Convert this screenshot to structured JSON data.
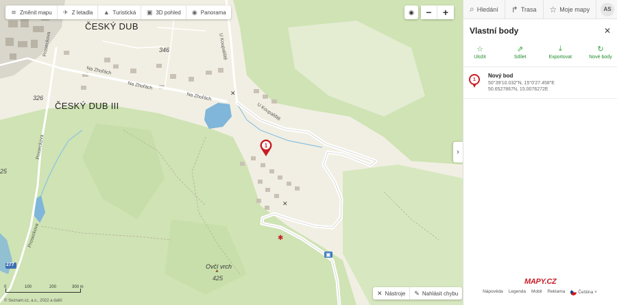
{
  "map": {
    "toolbar": [
      {
        "icon": "layers-icon",
        "label": "Změnit mapu"
      },
      {
        "icon": "plane-icon",
        "label": "Z letadla"
      },
      {
        "icon": "mountain-icon",
        "label": "Turistická"
      },
      {
        "icon": "cube-icon",
        "label": "3D pohled"
      },
      {
        "icon": "eye-icon",
        "label": "Panorama"
      }
    ],
    "zoom": {
      "locate_icon": "target-icon",
      "minus": "−",
      "plus": "+"
    },
    "labels": {
      "town1": "ČESKÝ DUB",
      "town2": "ČESKÝ DUB III",
      "elev346": "346",
      "elev326": "326",
      "elev25": "25",
      "elev425": "425",
      "peak": "Ovčí vrch",
      "street_zhorach1": "Na Zhořách",
      "street_zhorach2": "Na Zhořách",
      "street_zhorach3": "Na Zhořách",
      "street_koupaliste1": "U Koupaliště",
      "street_koupaliste2": "U Koupaliště",
      "street_proseckova1": "Proseckova",
      "street_proseckova2": "Proseckova",
      "street_proseckova3": "Proseckova",
      "road_277": "277"
    },
    "pin_number": "1",
    "tools": [
      {
        "icon": "tools-icon",
        "label": "Nástroje"
      },
      {
        "icon": "pencil-icon",
        "label": "Nahlásit chybu"
      }
    ],
    "scale": {
      "t0": "0",
      "t1": "100",
      "t2": "200",
      "t3": "300 m"
    },
    "copyright": "© Seznam.cz, a.s., 2022 a další"
  },
  "panel": {
    "nav": [
      {
        "icon": "search-icon",
        "label": "Hledání"
      },
      {
        "icon": "route-icon",
        "label": "Trasa"
      },
      {
        "icon": "star-icon",
        "label": "Moje mapy"
      }
    ],
    "avatar": "AS",
    "title": "Vlastní body",
    "actions": [
      {
        "icon": "star-icon",
        "label": "Uložit"
      },
      {
        "icon": "share-icon",
        "label": "Sdílet"
      },
      {
        "icon": "download-icon",
        "label": "Exportovat"
      },
      {
        "icon": "refresh-icon",
        "label": "Nové body"
      }
    ],
    "point": {
      "number": "1",
      "name": "Nový bod",
      "dms": "50°39'10.032\"N, 15°0'27.458\"E",
      "decimal": "50.6527867N, 15.0076272E"
    },
    "logo": "MAPY.CZ",
    "footer": [
      "Nápověda",
      "Legenda",
      "Mobil",
      "Reklama",
      "Čeština"
    ]
  },
  "colors": {
    "accent_green": "#2fa23c",
    "pin_red": "#c81d25",
    "water": "#7fb6d9",
    "forest": "#cfe3b4"
  }
}
